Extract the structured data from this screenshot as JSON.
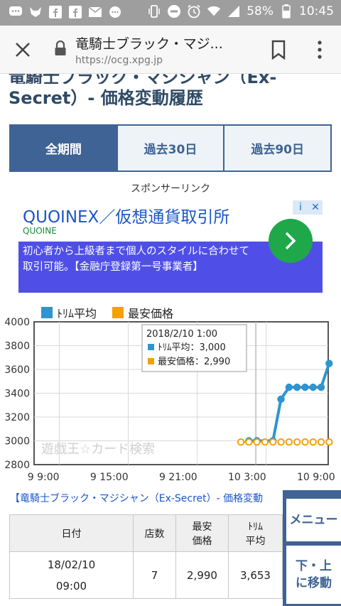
{
  "status_bar": {
    "battery": "58%",
    "time": "10:45"
  },
  "browser": {
    "page_title": "竜騎士ブラック・マジ...",
    "url": "https://ocg.xpg.jp"
  },
  "page": {
    "heading": "Secret）- 価格変動履歴",
    "heading_cut": "竜騎士ブラック・マジシャン（Ex-"
  },
  "tabs": [
    {
      "label": "全期間",
      "active": true
    },
    {
      "label": "過去30日",
      "active": false
    },
    {
      "label": "過去90日",
      "active": false
    }
  ],
  "ad": {
    "sponsor_label": "スポンサーリンク",
    "title": "QUOINEX／仮想通貨取引所",
    "brand": "QUOINE",
    "body": "初心者から上級者まで個人のスタイルに合わせて取引可能。【金融庁登録第一号事業者】",
    "info_icon": "i",
    "close_icon": "✕"
  },
  "chart_data": {
    "type": "line",
    "x": [
      "2018/2/9 21:00",
      "2018/2/10 0:00",
      "2018/2/10 1:00",
      "2018/2/10 2:00",
      "2018/2/10 3:00",
      "2018/2/10 4:00",
      "2018/2/10 5:00",
      "2018/2/10 6:00",
      "2018/2/10 7:00",
      "2018/2/10 8:00",
      "2018/2/10 9:00"
    ],
    "x_hours": [],
    "series": [
      {
        "name": "ﾄﾘﾑ平均",
        "color": "#2f94cf",
        "points": [
          [
            40,
            3000
          ],
          [
            41,
            3000
          ],
          [
            43,
            3000
          ],
          [
            44,
            3350
          ],
          [
            45,
            3450
          ],
          [
            46,
            3450
          ],
          [
            47,
            3450
          ],
          [
            48,
            3450
          ],
          [
            49,
            3450
          ],
          [
            50,
            3650
          ]
        ]
      },
      {
        "name": "最安価格",
        "color": "#f5a000",
        "points": [
          [
            39,
            2990
          ],
          [
            40,
            2990
          ],
          [
            41,
            2990
          ],
          [
            42,
            2990
          ],
          [
            43,
            2990
          ],
          [
            44,
            2990
          ],
          [
            45,
            2990
          ],
          [
            46,
            2990
          ],
          [
            47,
            2990
          ],
          [
            48,
            2990
          ],
          [
            49,
            2990
          ],
          [
            50,
            2990
          ]
        ]
      }
    ],
    "x_range": [
      24,
      51
    ],
    "y_range": [
      2800,
      4000
    ],
    "y_ticks": [
      "4000",
      "3800",
      "3600",
      "3400",
      "3200",
      "3000",
      "2800"
    ],
    "x_ticks": [
      {
        "value": 33,
        "label": "9 9:00"
      },
      {
        "value": 39,
        "label": "9 15:00"
      },
      {
        "value": 45,
        "label": "9 21:00"
      },
      {
        "value": 51,
        "label": "10 3:00"
      },
      {
        "value": 57,
        "label": "10 9:00"
      }
    ],
    "grid": true,
    "legend": "top-left",
    "watermark": "遊戯王☆カード検索",
    "tooltip": {
      "title": "2018/2/10 1:00",
      "rows": [
        "ﾄﾘﾑ平均：3,000",
        "最安価格：2,990"
      ]
    }
  },
  "link": {
    "text": "【竜騎士ブラック・マジシャン（Ex-Secret）- 価格変動"
  },
  "table": {
    "headers": [
      "日付",
      "店数",
      "最安\n価格",
      "ﾄﾘﾑ\n平均"
    ],
    "rows": [
      {
        "date": "18/02/10\n09:00",
        "shops": "7",
        "min": "2,990",
        "avg": "3,653"
      }
    ]
  },
  "float_menu": {
    "menu": "メニュー",
    "move": "下・上\nに移動"
  }
}
